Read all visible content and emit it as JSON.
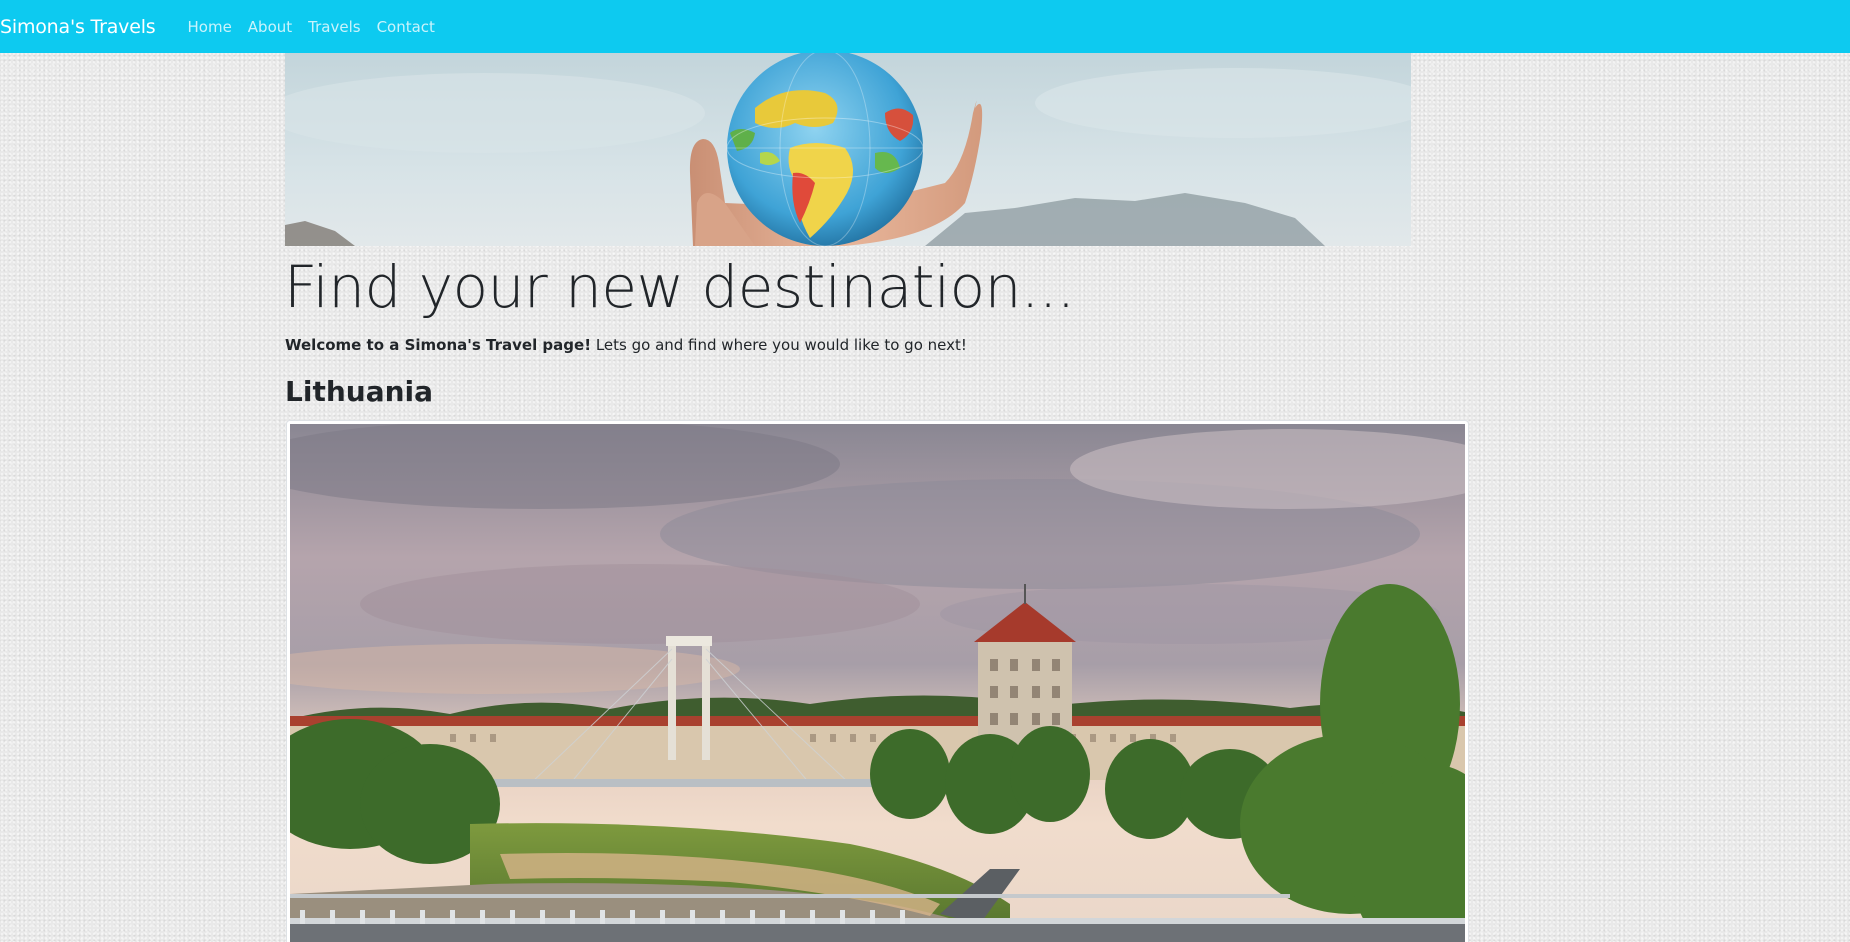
{
  "navbar": {
    "brand": "Simona's Travels",
    "links": [
      "Home",
      "About",
      "Travels",
      "Contact"
    ],
    "background_color": "#0dcaf0"
  },
  "hero": {
    "image_description_icon": "globe-in-hand-image"
  },
  "main": {
    "title": "Find your new destination...",
    "lead_bold": "Welcome to a Simona's Travel page!",
    "lead_rest": " Lets go and find where you would like to go next!",
    "section_title": "Lithuania",
    "section_image_icon": "kaunas-cityscape-image"
  }
}
